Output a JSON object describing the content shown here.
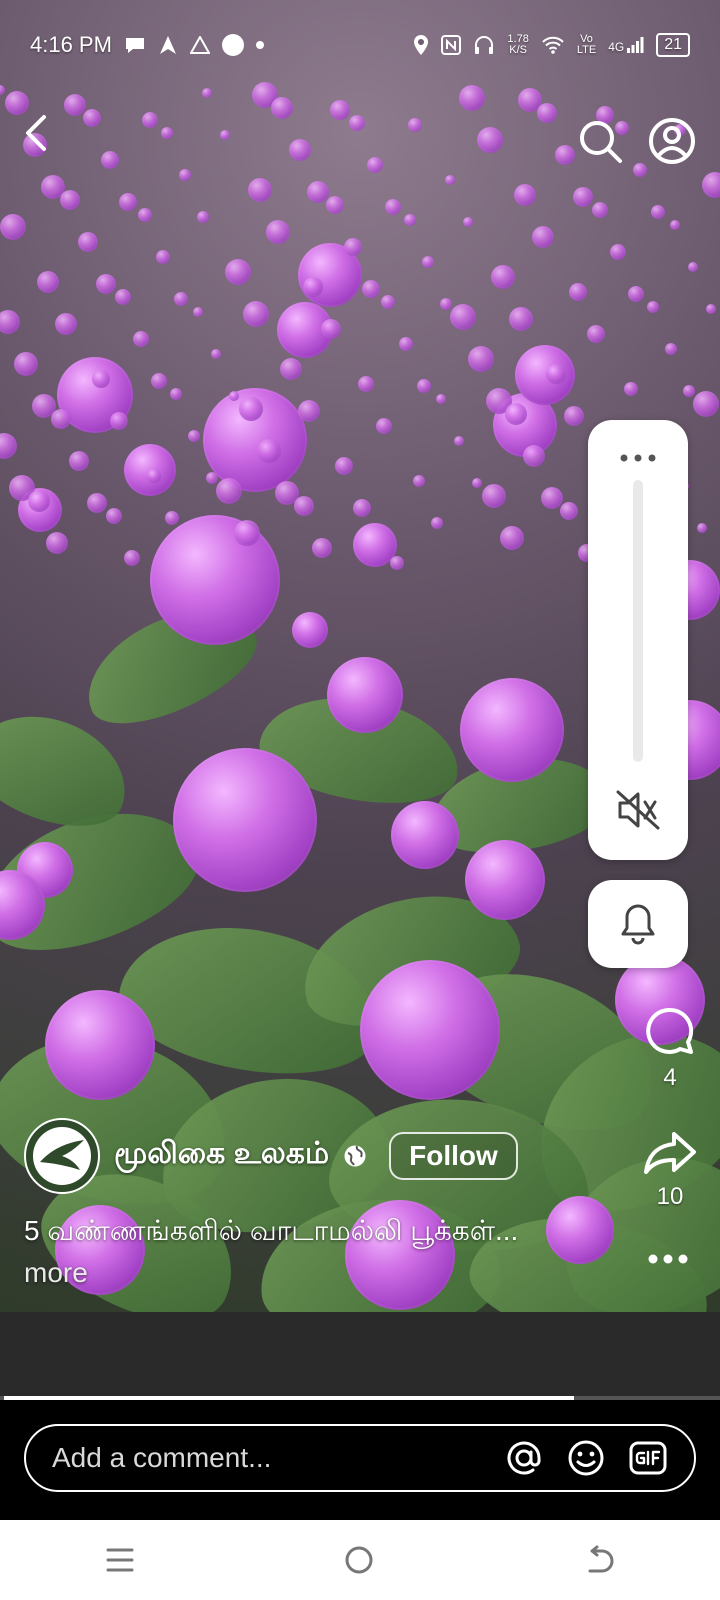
{
  "status_bar": {
    "time": "4:16 PM",
    "network_speed_value": "1.78",
    "network_speed_unit": "K/S",
    "volte_top": "Vo",
    "volte_bottom": "LTE",
    "network_type": "4G",
    "battery": "21"
  },
  "author": {
    "name": "மூலிகை உலகம்",
    "follow_label": "Follow"
  },
  "caption": {
    "text": "5 வண்ணங்களில் வாடாமல்லி பூக்கள்...",
    "more_label": "more"
  },
  "actions": {
    "comment_count": "4",
    "share_count": "10"
  },
  "video": {
    "progress_fraction": 0.8
  },
  "comment_bar": {
    "placeholder": "Add a comment..."
  },
  "colors": {
    "accent_bloom": "#c85fe0",
    "panel_bg": "#ffffff",
    "dark_strip": "#2a2a2a"
  }
}
